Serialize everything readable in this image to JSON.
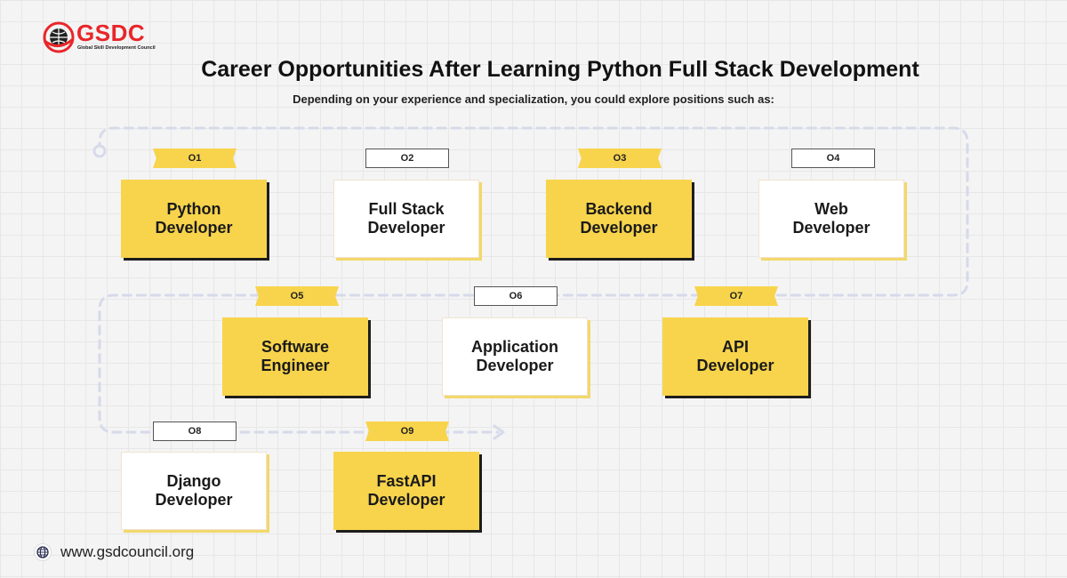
{
  "brand": {
    "name": "GSDC",
    "tagline": "Global Skill Development Council",
    "accent_color": "#e8262a"
  },
  "header": {
    "title": "Career Opportunities After Learning Python Full Stack Development",
    "subtitle": "Depending on your experience and specialization, you could explore positions such as:"
  },
  "roles": [
    {
      "number": "O1",
      "label": "Python\nDeveloper",
      "style": "yellow"
    },
    {
      "number": "O2",
      "label": "Full Stack\nDeveloper",
      "style": "white"
    },
    {
      "number": "O3",
      "label": "Backend\nDeveloper",
      "style": "yellow"
    },
    {
      "number": "O4",
      "label": "Web\nDeveloper",
      "style": "white"
    },
    {
      "number": "O5",
      "label": "Software\nEngineer",
      "style": "yellow"
    },
    {
      "number": "O6",
      "label": "Application\nDeveloper",
      "style": "white"
    },
    {
      "number": "O7",
      "label": "API\nDeveloper",
      "style": "yellow"
    },
    {
      "number": "O8",
      "label": "Django\nDeveloper",
      "style": "white"
    },
    {
      "number": "O9",
      "label": "FastAPI\nDeveloper",
      "style": "yellow"
    }
  ],
  "footer": {
    "website": "www.gsdcouncil.org",
    "icon": "globe-icon"
  },
  "colors": {
    "card_yellow": "#f8d44c",
    "path_line": "#d6daea"
  }
}
